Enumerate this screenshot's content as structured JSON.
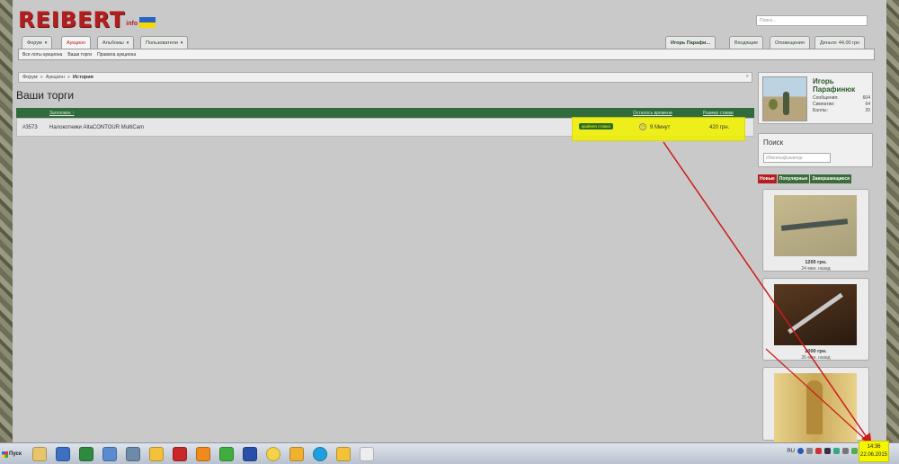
{
  "header": {
    "logo_text": "REIBERT",
    "logo_sub": "info",
    "search_placeholder": "Поиск..."
  },
  "nav": {
    "tabs": [
      {
        "label": "Форум"
      },
      {
        "label": "Аукцион"
      },
      {
        "label": "Альбомы"
      },
      {
        "label": "Пользователи"
      }
    ],
    "right": {
      "user": "Игорь Парафи...",
      "inbox": "Входящие",
      "alerts": "Оповещения",
      "money": "Деньги: 44,00 грн"
    }
  },
  "subnav": {
    "items": [
      "Все лоты аукциона",
      "Ваши торги",
      "Правила аукциона"
    ]
  },
  "breadcrumb": {
    "items": [
      "Форум",
      "Аукцион",
      "История"
    ],
    "sep": "»"
  },
  "page_title": "Ваши торги",
  "table": {
    "headers": {
      "title": "Заголовок ↑",
      "time_left": "Осталось времени",
      "bid_size": "Размер ставки"
    },
    "rows": [
      {
        "id": "#3573",
        "title": "Налокотники AltaCONTOUR MultiCam",
        "badge": "крайняя ставка",
        "time_left": "9 Минут",
        "bid": "420 грн."
      }
    ]
  },
  "profile": {
    "name_line1": "Игорь",
    "name_line2": "Парафинюк",
    "stats": [
      {
        "label": "Сообщения:",
        "value": "604"
      },
      {
        "label": "Симпатии:",
        "value": "64"
      },
      {
        "label": "Баллы:",
        "value": "20"
      }
    ]
  },
  "sidebar_search": {
    "title": "Поиск",
    "placeholder": "Идентификатор"
  },
  "sidebar_tabs": [
    "Новые",
    "Популярные",
    "Завершающиеся"
  ],
  "lots": [
    {
      "price": "1200 грн.",
      "ago": "24 мин. назад"
    },
    {
      "price": "2000 грн.",
      "ago": "26 мин. назад"
    },
    {
      "price": "",
      "ago": ""
    }
  ],
  "taskbar": {
    "start_label": "Пуск",
    "lang": "RU",
    "time": "14:36",
    "date": "22.06.2015"
  },
  "colors": {
    "accent_red": "#b41e1e",
    "header_green": "#2f6b3c",
    "highlight_yellow": "#f0f000",
    "annotation_red": "#d01818"
  }
}
